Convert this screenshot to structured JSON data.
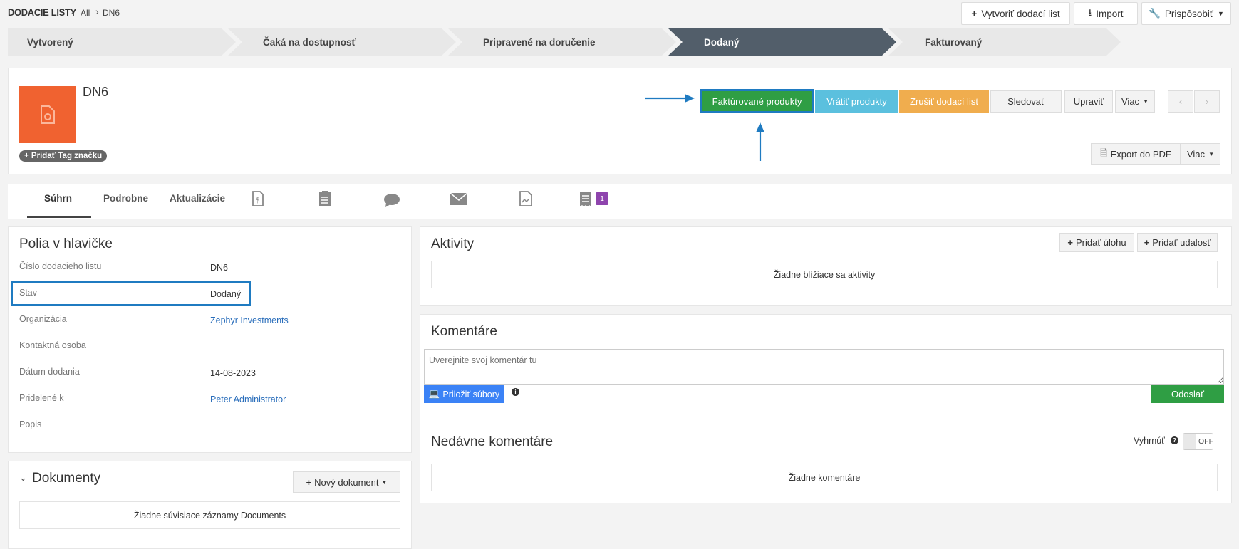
{
  "breadcrumb": {
    "module": "DODACIE LISTY",
    "all": "All",
    "record": "DN6"
  },
  "top_actions": {
    "create": "Vytvoriť dodací list",
    "import": "Import",
    "customize": "Prispôsobiť"
  },
  "pipeline": [
    "Vytvorený",
    "Čaká na dostupnosť",
    "Pripravené na doručenie",
    "Dodaný",
    "Fakturovaný"
  ],
  "record": {
    "title": "DN6",
    "add_tag": "Pridať Tag značku"
  },
  "record_actions": {
    "invoiced": "Faktúrované produkty",
    "return": "Vrátiť produkty",
    "cancel": "Zrušiť dodací list",
    "follow": "Sledovať",
    "edit": "Upraviť",
    "more": "Viac",
    "export_pdf": "Export do PDF",
    "more2": "Viac"
  },
  "tabs": {
    "summary": "Súhrn",
    "detail": "Podrobne",
    "updates": "Aktualizácie",
    "badge_count": "1"
  },
  "header_fields": {
    "title": "Polia v hlavičke",
    "rows": [
      {
        "label": "Číslo dodacieho listu",
        "value": "DN6"
      },
      {
        "label": "Stav",
        "value": "Dodaný"
      },
      {
        "label": "Organizácia",
        "value": "Zephyr Investments"
      },
      {
        "label": "Kontaktná osoba",
        "value": ""
      },
      {
        "label": "Dátum dodania",
        "value": "14-08-2023"
      },
      {
        "label": "Pridelené k",
        "value": "Peter Administrator"
      },
      {
        "label": "Popis",
        "value": ""
      }
    ]
  },
  "documents": {
    "title": "Dokumenty",
    "new_button": "Nový dokument",
    "empty": "Žiadne súvisiace záznamy Documents"
  },
  "activities": {
    "title": "Aktivity",
    "add_task": "Pridať úlohu",
    "add_event": "Pridať udalosť",
    "empty": "Žiadne blížiace sa aktivity"
  },
  "comments": {
    "title": "Komentáre",
    "placeholder": "Uverejnite svoj komentár tu",
    "attach": "Priložiť súbory",
    "send": "Odoslať",
    "recent_title": "Nedávne komentáre",
    "collapse_label": "Vyhrnúť",
    "toggle": "OFF",
    "empty": "Žiadne komentáre"
  },
  "colors": {
    "green": "#2f9e44",
    "blue": "#5bc0de",
    "orange": "#f0ad4e",
    "tile": "#f06230",
    "pipeline_active": "#525e6a",
    "highlight": "#1f7bc1"
  }
}
